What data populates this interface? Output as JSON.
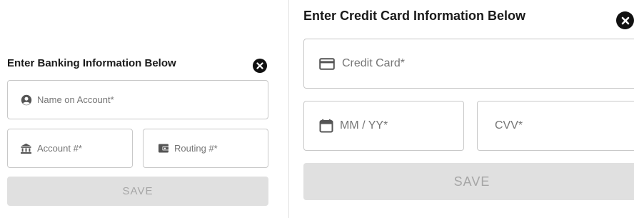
{
  "banking": {
    "title": "Enter Banking Information Below",
    "name_placeholder": "Name on Account*",
    "account_placeholder": "Account #*",
    "routing_placeholder": "Routing #*",
    "save_label": "SAVE",
    "close_icon": "close-circle-icon",
    "name_icon": "account-circle-icon",
    "account_icon": "bank-icon",
    "routing_icon": "wallet-icon"
  },
  "credit": {
    "title": "Enter Credit Card Information Below",
    "card_placeholder": "Credit Card*",
    "expiry_placeholder": "MM / YY*",
    "cvv_placeholder": "CVV*",
    "save_label": "SAVE",
    "close_icon": "close-circle-icon",
    "card_icon": "credit-card-icon",
    "expiry_icon": "calendar-icon"
  },
  "colors": {
    "border": "#c8c8c8",
    "button_bg": "#e0e0e0",
    "button_text": "#a6a6a6",
    "placeholder": "#757575",
    "close_bg": "#111111"
  }
}
